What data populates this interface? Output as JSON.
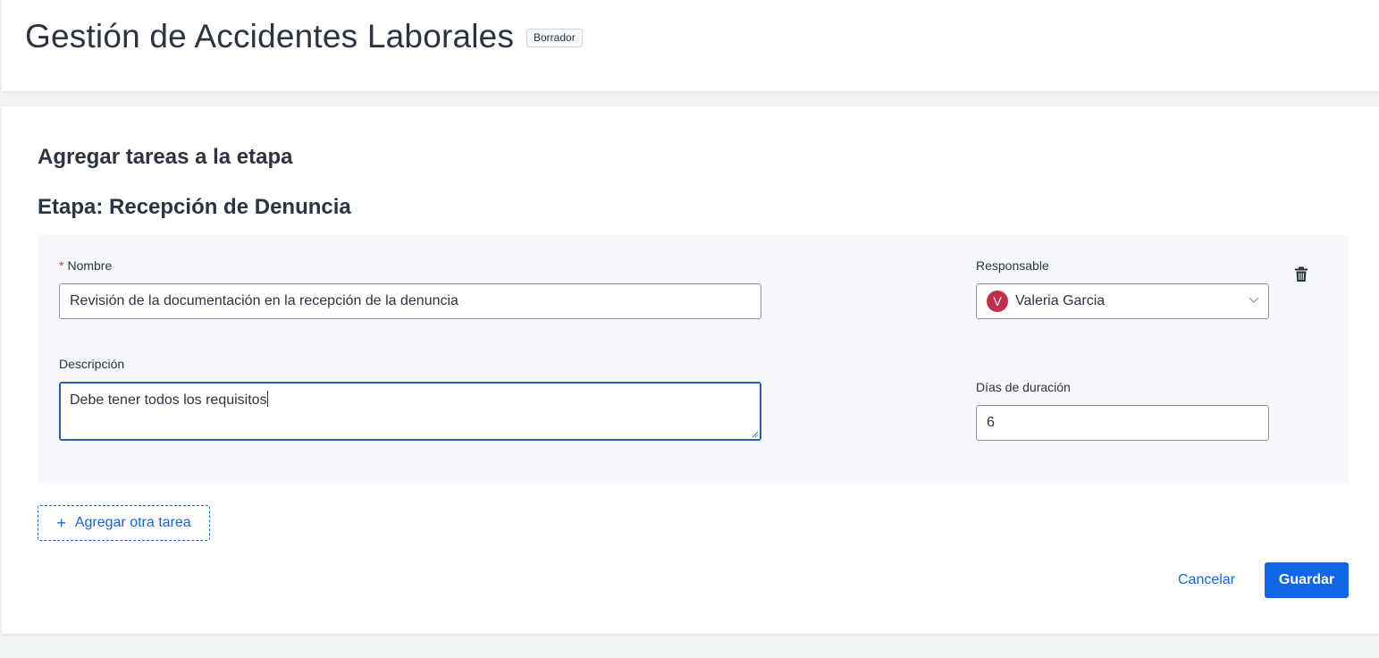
{
  "header": {
    "title": "Gestión de Accidentes Laborales",
    "status_badge": "Borrador"
  },
  "form": {
    "section_title": "Agregar tareas a la etapa",
    "stage_title": "Etapa: Recepción de Denuncia",
    "task": {
      "name_required_mark": "*",
      "name_label": "Nombre",
      "name_value": "Revisión de la documentación en la recepción de la denuncia",
      "description_label": "Descripción",
      "description_value": "Debe tener todos los requisitos",
      "responsible_label": "Responsable",
      "responsible_initial": "V",
      "responsible_value": "Valeria Garcia",
      "duration_label": "Días de duración",
      "duration_value": "6",
      "delete_icon": "trash-icon"
    },
    "add_task_icon": "plus-icon",
    "add_task_label": "Agregar otra tarea"
  },
  "footer": {
    "cancel_label": "Cancelar",
    "save_label": "Guardar"
  },
  "colors": {
    "primary": "#1266e6",
    "avatar": "#c0304a",
    "task_box_bg": "#f6f8fc",
    "required": "#d23b3b"
  }
}
